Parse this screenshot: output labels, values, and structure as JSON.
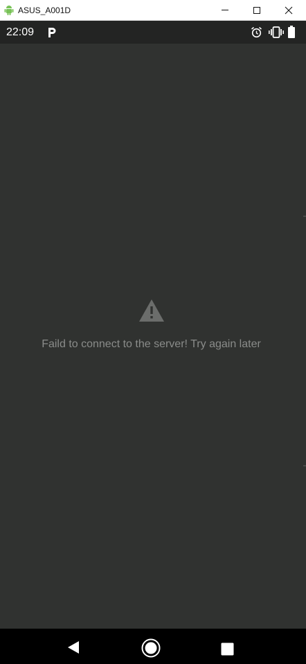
{
  "window": {
    "title": "ASUS_A001D",
    "app_icon": "android-icon",
    "controls": [
      "minimize-icon",
      "maximize-icon",
      "close-icon"
    ]
  },
  "status_bar": {
    "time": "22:09",
    "icons": [
      "p-notification-icon",
      "alarm-icon",
      "vibrate-icon",
      "battery-icon"
    ]
  },
  "content": {
    "icon": "warning-icon",
    "message": "Faild to connect to the server! Try again later"
  },
  "nav_bar": {
    "buttons": [
      "back-icon",
      "home-icon",
      "recents-icon"
    ]
  },
  "colors": {
    "background": "#303230",
    "status_bar": "#232423",
    "nav_bar": "#000000",
    "message_text": "#8a8c8a",
    "warning_icon": "#6b6d6b",
    "android_green": "#78c257"
  }
}
